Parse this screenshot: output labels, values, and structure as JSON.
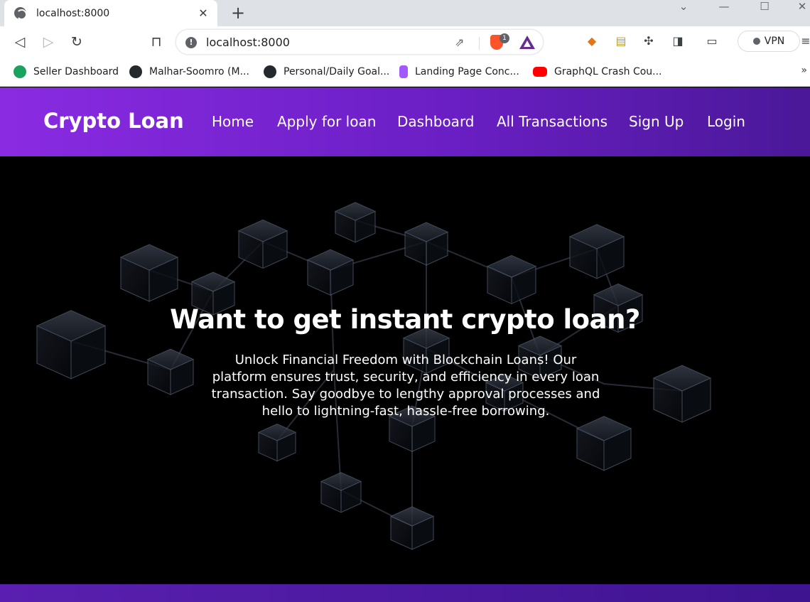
{
  "browser": {
    "tab_title": "localhost:8000",
    "tab_close": "✕",
    "new_tab": "+",
    "url": "localhost:8000",
    "brave_badge": "1",
    "vpn_label": "VPN",
    "bookmarks": [
      {
        "label": "Seller Dashboard",
        "icon": "seller-icon",
        "color": "#1aa260"
      },
      {
        "label": "Malhar-Soomro (M...",
        "icon": "github-icon",
        "color": "#24292e"
      },
      {
        "label": "Personal/Daily Goal...",
        "icon": "github-icon",
        "color": "#24292e"
      },
      {
        "label": "Landing Page Conc...",
        "icon": "figma-icon",
        "color": "#a259ff"
      },
      {
        "label": "GraphQL Crash Cou...",
        "icon": "youtube-icon",
        "color": "#ff0000"
      }
    ],
    "bookmarks_more": "»"
  },
  "site": {
    "brand": "Crypto Loan",
    "nav": [
      "Home",
      "Apply for loan",
      "Dashboard",
      "All Transactions",
      "Sign Up",
      "Login"
    ],
    "header_gradient": [
      "#8a2be2",
      "#4a1898"
    ]
  },
  "hero": {
    "title": "Want to get instant crypto loan?",
    "text": "Unlock Financial Freedom with Blockchain Loans! Our platform ensures trust, security, and efficiency in every loan transaction. Say goodbye to lengthy approval processes and hello to lightning-fast, hassle-free borrowing."
  }
}
